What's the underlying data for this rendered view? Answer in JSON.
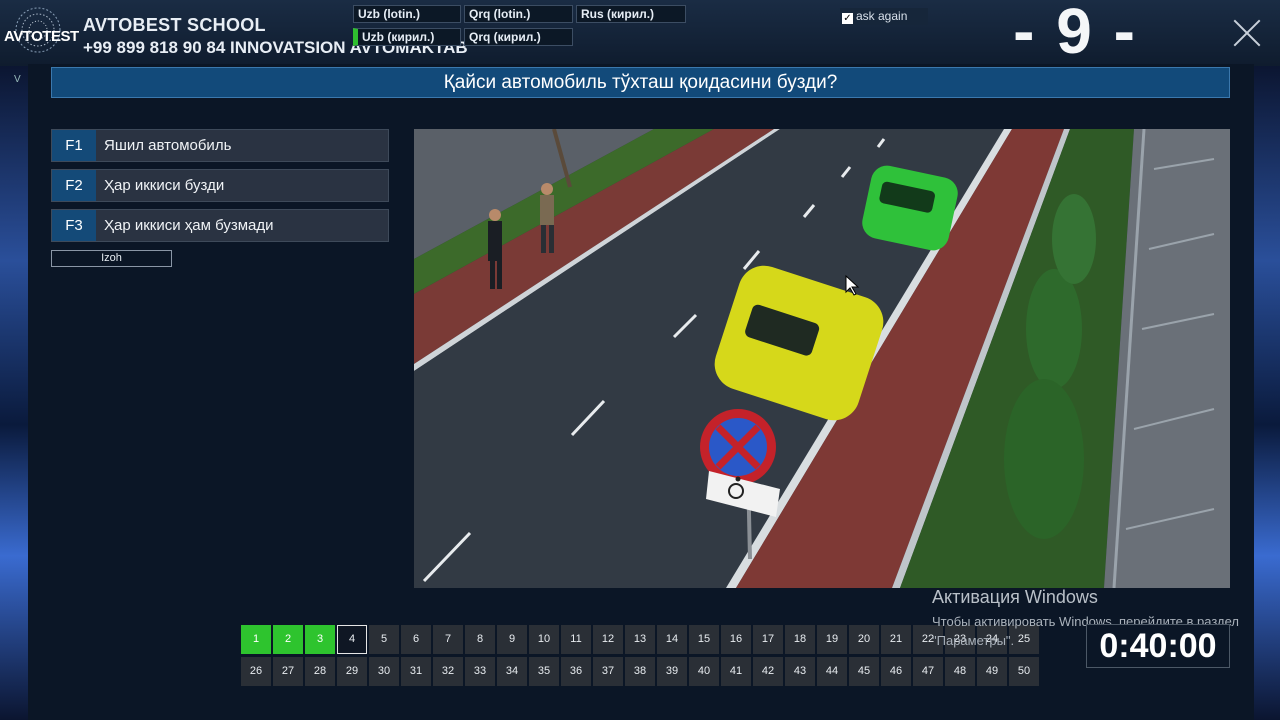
{
  "header": {
    "logo_text": "AVTOTEST",
    "school_name": "AVTOBEST SCHOOL",
    "phone": "+99 899 818 90 84 INNOVATSION AVTOMAKTAB",
    "languages": [
      {
        "label": "Uzb (lotin.)",
        "active": false
      },
      {
        "label": "Qrq (lotin.)",
        "active": false
      },
      {
        "label": "Rus (кирил.)",
        "active": false
      },
      {
        "label": "Uzb (кирил.)",
        "active": true
      },
      {
        "label": "Qrq (кирил.)",
        "active": false
      }
    ],
    "ask_again_label": "ask again",
    "ask_again_checked": true,
    "question_number": "- 9 -"
  },
  "side_letter": "V",
  "question": {
    "text": "Қайси автомобиль тўхташ қоидасини бузди?"
  },
  "answers": [
    {
      "key": "F1",
      "text": "Яшил автомобиль"
    },
    {
      "key": "F2",
      "text": "Ҳар иккиси бузди"
    },
    {
      "key": "F3",
      "text": "Ҳар иккиси ҳам бузмади"
    }
  ],
  "izoh_label": "Izoh",
  "scene": {
    "description_icons": [
      "road",
      "green-car",
      "yellow-car",
      "no-stopping-sign",
      "disabled-parking-plate",
      "pedestrians",
      "trees",
      "fence"
    ]
  },
  "navigation": {
    "row1": [
      "1",
      "2",
      "3",
      "4",
      "5",
      "6",
      "7",
      "8",
      "9",
      "10",
      "11",
      "12",
      "13",
      "14",
      "15",
      "16",
      "17",
      "18",
      "19",
      "20",
      "21",
      "22",
      "23",
      "24",
      "25"
    ],
    "row2": [
      "26",
      "27",
      "28",
      "29",
      "30",
      "31",
      "32",
      "33",
      "34",
      "35",
      "36",
      "37",
      "38",
      "39",
      "40",
      "41",
      "42",
      "43",
      "44",
      "45",
      "46",
      "47",
      "48",
      "49",
      "50"
    ],
    "done": [
      "1",
      "2",
      "3"
    ],
    "current": "4"
  },
  "watermark": {
    "title": "Активация Windows",
    "subtitle": "Чтобы активировать Windows, перейдите в раздел \"Параметры\"."
  },
  "timer": "0:40:00",
  "colors": {
    "accent": "#124a7a",
    "done": "#2ec42e",
    "panel": "#2a3342"
  }
}
